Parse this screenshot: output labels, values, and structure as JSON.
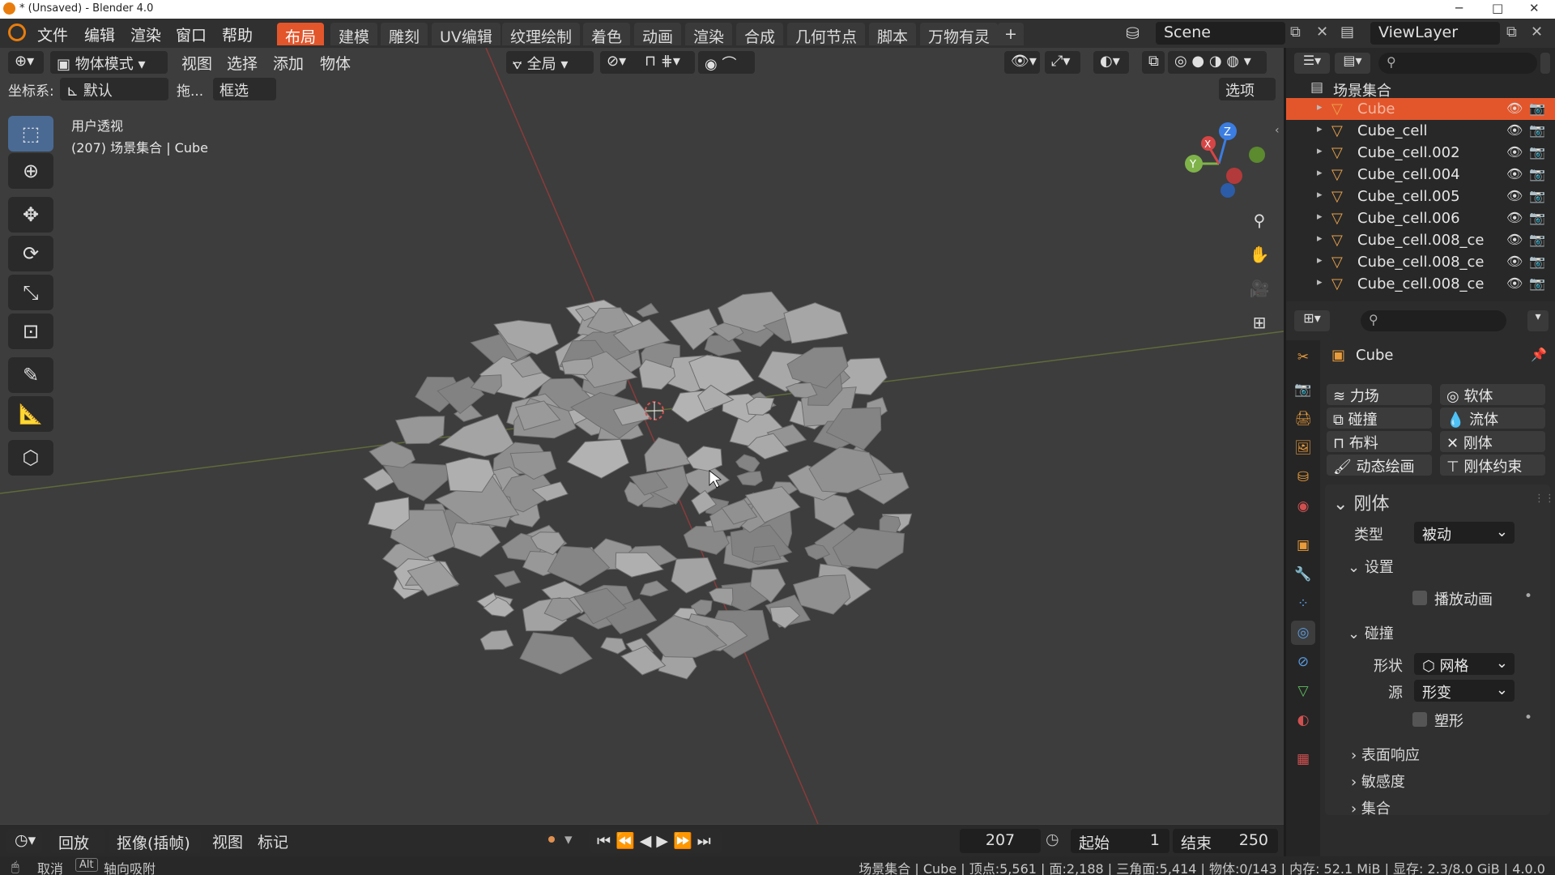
{
  "window": {
    "title": "* (Unsaved) - Blender 4.0",
    "minimize": "─",
    "maximize": "□",
    "close": "✕"
  },
  "menu": [
    "文件",
    "编辑",
    "渲染",
    "窗口",
    "帮助"
  ],
  "workspaces": [
    "布局",
    "建模",
    "雕刻",
    "UV编辑",
    "纹理绘制",
    "着色",
    "动画",
    "渲染",
    "合成",
    "几何节点",
    "脚本",
    "万物有灵"
  ],
  "workspace_add": "+",
  "scene": {
    "name": "Scene",
    "view_layer": "ViewLayer"
  },
  "viewport_header": {
    "mode": "物体模式",
    "menus": [
      "视图",
      "选择",
      "添加",
      "物体"
    ],
    "transform": "全局",
    "coord_label": "坐标系:",
    "coord_value": "默认",
    "drag_label": "拖...",
    "drag_value": "框选",
    "options": "选项"
  },
  "viewport_info": {
    "line1": "用户透视",
    "line2": "(207) 场景集合 | Cube"
  },
  "gizmo": {
    "x": "X",
    "y": "Y",
    "z": "Z"
  },
  "outliner": {
    "collection": "场景集合",
    "items": [
      {
        "name": "Cube",
        "selected": true
      },
      {
        "name": "Cube_cell",
        "selected": false
      },
      {
        "name": "Cube_cell.002",
        "selected": false
      },
      {
        "name": "Cube_cell.004",
        "selected": false
      },
      {
        "name": "Cube_cell.005",
        "selected": false
      },
      {
        "name": "Cube_cell.006",
        "selected": false
      },
      {
        "name": "Cube_cell.008_ce",
        "selected": false
      },
      {
        "name": "Cube_cell.008_ce",
        "selected": false
      },
      {
        "name": "Cube_cell.008_ce",
        "selected": false
      }
    ]
  },
  "properties": {
    "object_name": "Cube",
    "physics_buttons": [
      "力场",
      "软体",
      "碰撞",
      "流体",
      "布料",
      "刚体",
      "动态绘画",
      "刚体约束"
    ],
    "rigid_body": {
      "title": "刚体",
      "type_label": "类型",
      "type_value": "被动",
      "settings_label": "设置",
      "animated_label": "播放动画",
      "collisions_label": "碰撞",
      "shape_label": "形状",
      "shape_value": "网格",
      "source_label": "源",
      "source_value": "形变",
      "deform_label": "塑形",
      "surface_label": "表面响应",
      "sensitivity_label": "敏感度",
      "collections_label": "集合"
    }
  },
  "timeline": {
    "playback": "回放",
    "keying": "抠像(插帧)",
    "view": "视图",
    "marker": "标记",
    "current_frame": "207",
    "start_label": "起始",
    "start_value": "1",
    "end_label": "结束",
    "end_value": "250"
  },
  "statusbar": {
    "cancel": "取消",
    "alt_key": "Alt",
    "snap": "轴向吸附",
    "stats": "场景集合 | Cube | 顶点:5,561 | 面:2,188 | 三角面:5,414 | 物体:0/143 | 内存: 52.1 MiB | 显存: 2.3/8.0 GiB | 4.0.0"
  },
  "colors": {
    "accent": "#e3562b",
    "viewport_bg": "#3d3d3d",
    "panel_bg": "#2c2c2c",
    "fragment": "#9a9a9a"
  }
}
